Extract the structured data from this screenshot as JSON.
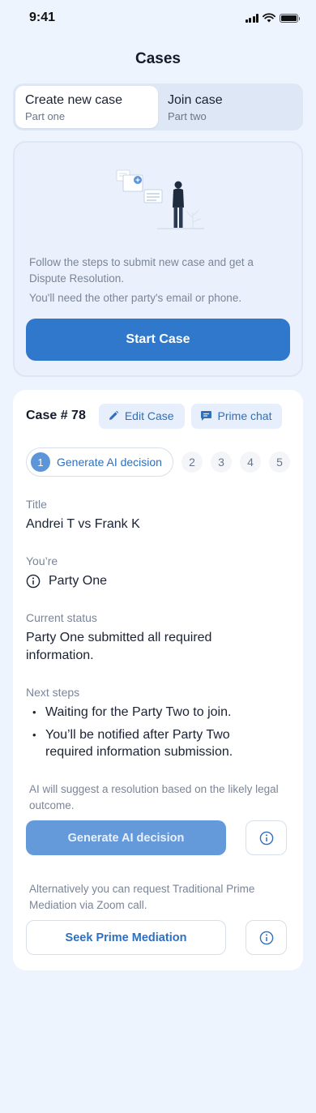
{
  "status_bar": {
    "time": "9:41"
  },
  "header": {
    "title": "Cases"
  },
  "segmented": [
    {
      "label": "Create new case",
      "sub": "Part one",
      "active": true
    },
    {
      "label": "Join case",
      "sub": "Part two",
      "active": false
    }
  ],
  "intro": {
    "line1": "Follow the steps to submit new case and get a Dispute Resolution.",
    "line2": "You'll need the other party's email or phone.",
    "start_button": "Start Case"
  },
  "case": {
    "number": "Case # 78",
    "edit_label": "Edit Case",
    "chat_label": "Prime chat",
    "steps": {
      "active_number": "1",
      "active_label": "Generate AI decision",
      "others": [
        "2",
        "3",
        "4",
        "5"
      ]
    },
    "title_label": "Title",
    "title_value": "Andrei T vs Frank K",
    "role_label": "You’re",
    "role_value": "Party One",
    "status_label": "Current status",
    "status_value": "Party One submitted all required information.",
    "next_label": "Next steps",
    "next_steps": [
      "Waiting for the Party Two to join.",
      "You’ll be notified after Party Two required information submission."
    ],
    "ai_hint": "AI will suggest a resolution based on the likely legal outcome.",
    "generate_button": "Generate AI decision",
    "mediation_hint": "Alternatively you can request Traditional Prime Mediation via Zoom call.",
    "seek_button": "Seek Prime Mediation"
  },
  "colors": {
    "background": "#EEF4FD",
    "primary": "#2F78CC",
    "primary_light": "#5C95D8",
    "accent_text": "#2E6FBE"
  },
  "icons": {
    "edit": "pencil-icon",
    "chat": "chat-bubble-icon",
    "info": "info-icon"
  }
}
